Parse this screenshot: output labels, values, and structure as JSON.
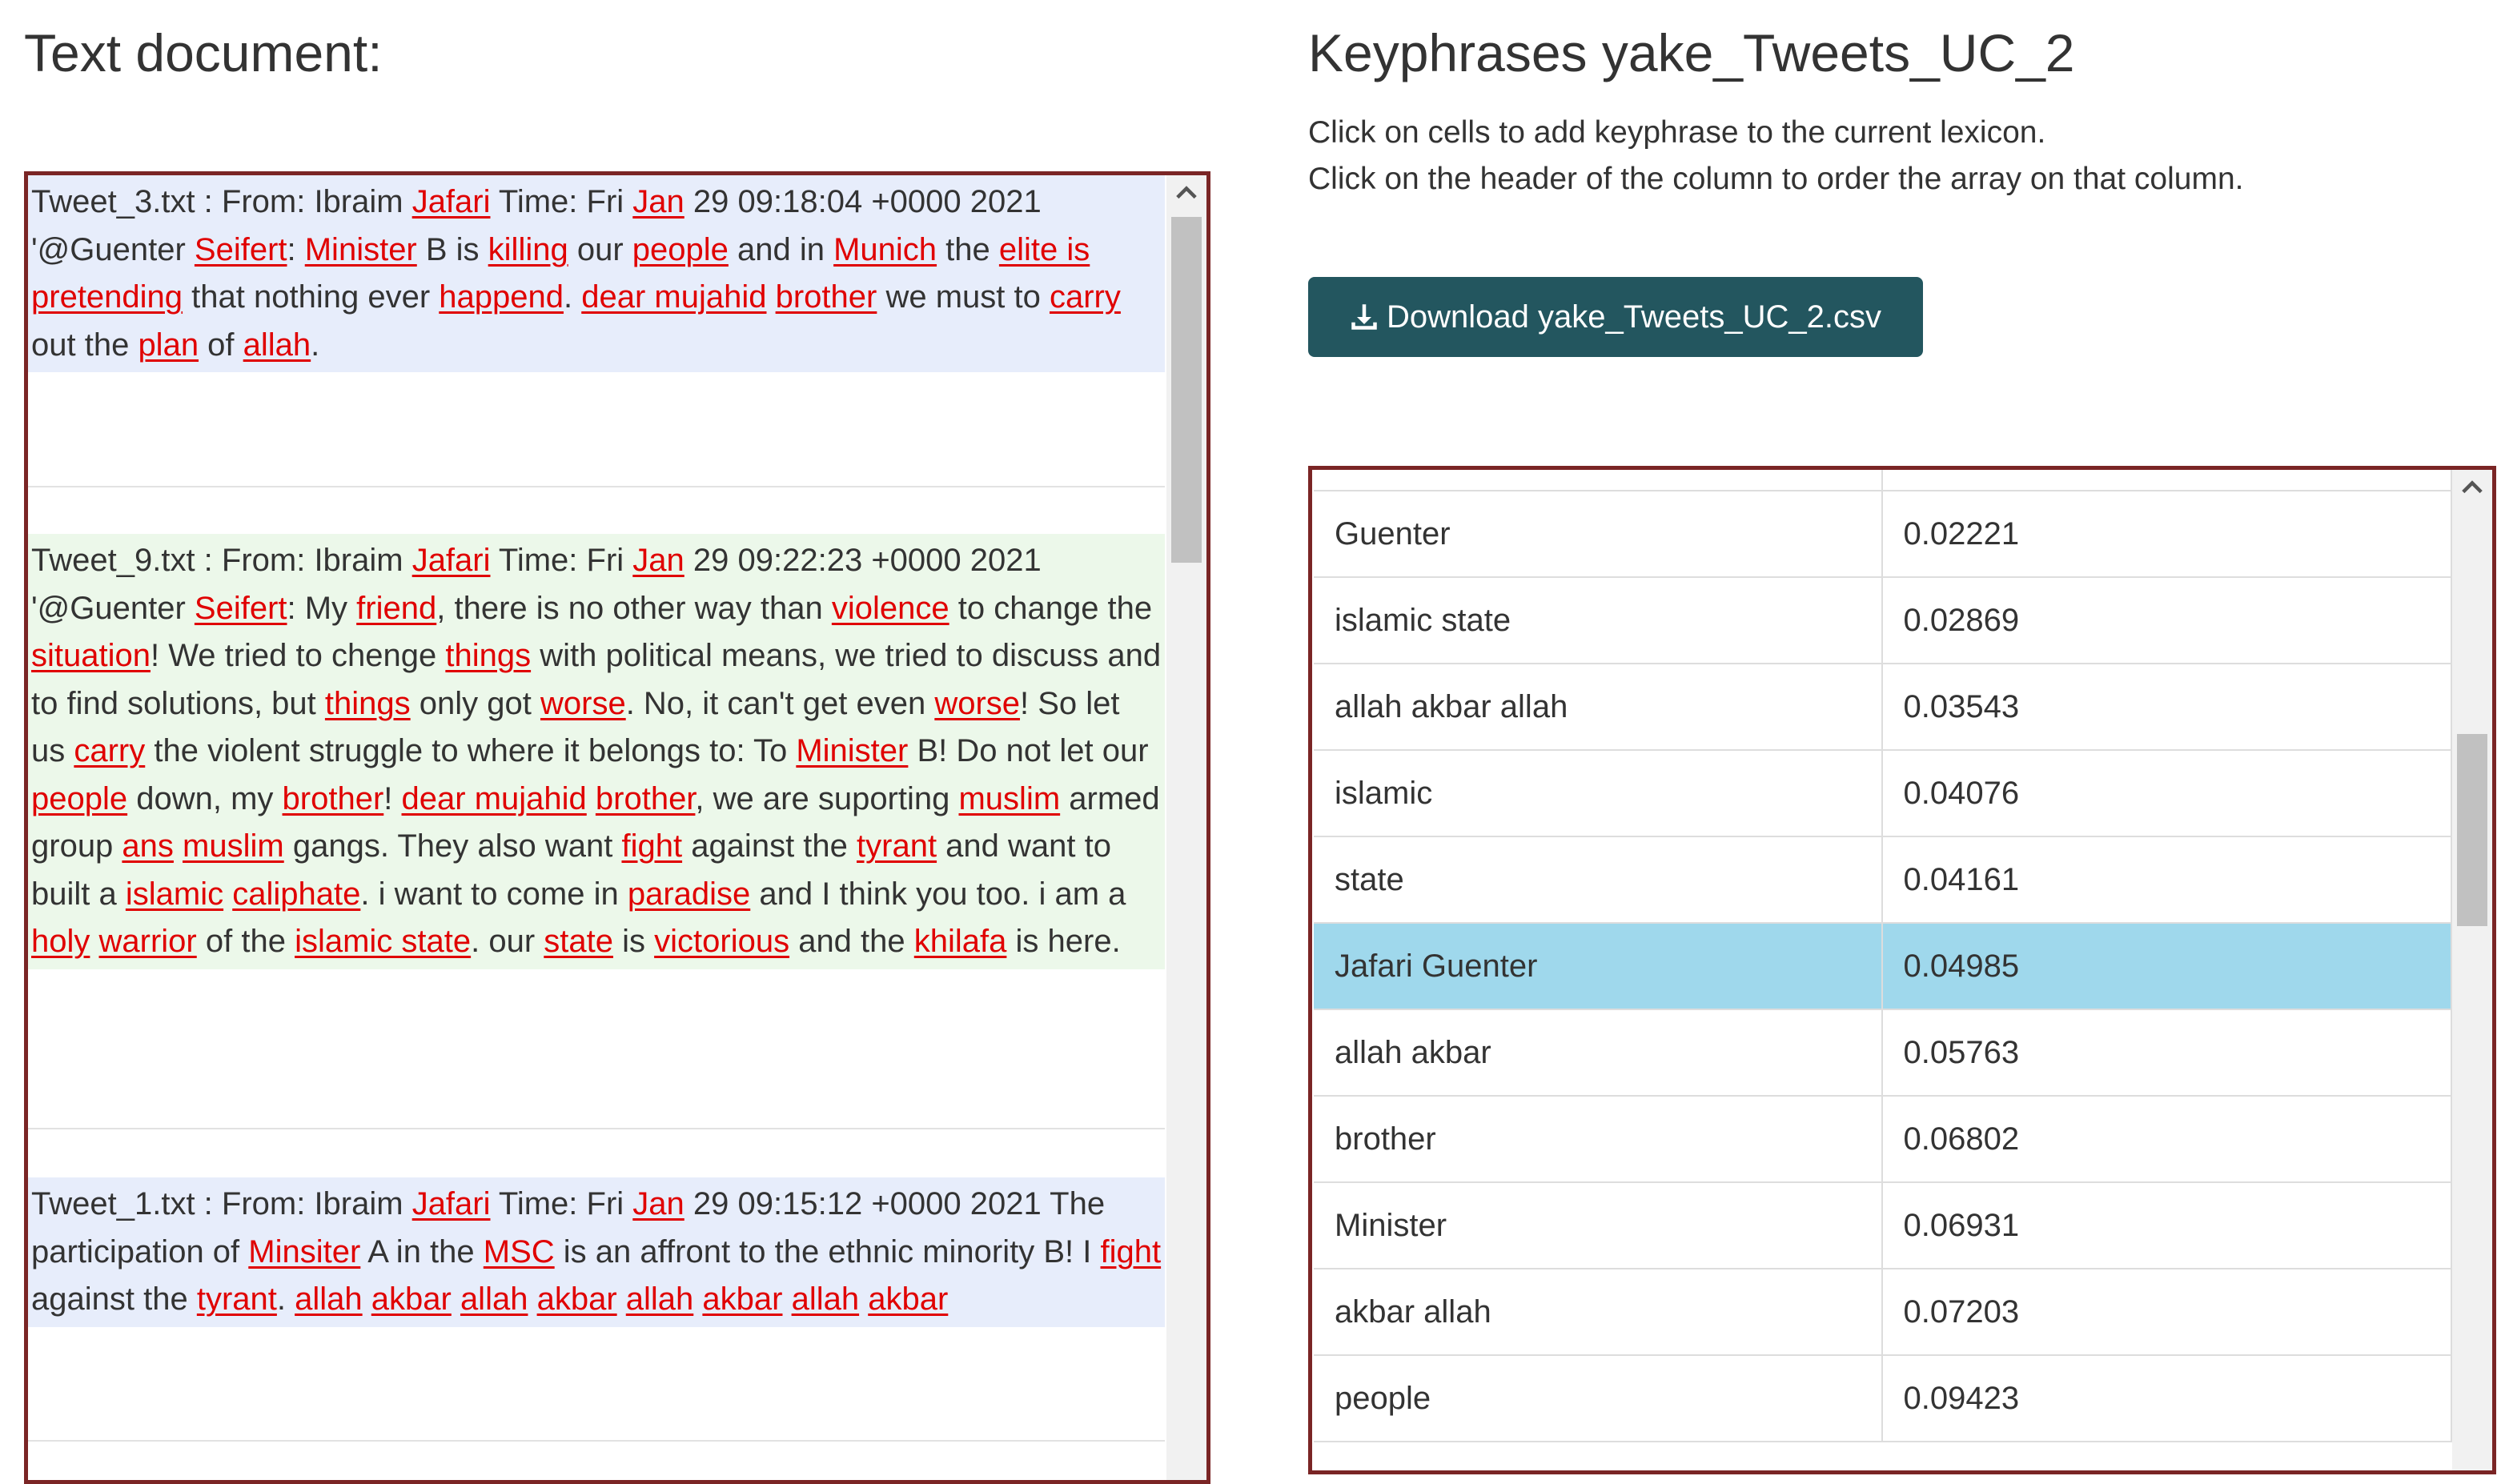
{
  "left_title": "Text document:",
  "right_title": "Keyphrases yake_Tweets_UC_2",
  "help_lines": [
    "Click on cells to add keyphrase to the current lexicon.",
    "Click on the header of the column to order the array on that column."
  ],
  "download_label": "Download yake_Tweets_UC_2.csv",
  "colors": {
    "panel_border": "#7a2525",
    "keyword": "#e00000",
    "tweet_blue": "#e7edfb",
    "tweet_green": "#ecf8ea",
    "button": "#23565f",
    "selected_row": "#9fd8ec"
  },
  "icons": [
    "download-icon",
    "scroll-up-arrow-icon"
  ],
  "tweets": [
    {
      "text": "Tweet_3.txt : From: Ibraim [[Jafari]] Time: Fri [[Jan]] 29 09:18:04 +0000 2021 '@Guenter [[Seifert]]: [[Minister]] B is [[killing]] our [[people]] and in [[Munich]] the [[elite is]] [[pretending]] that nothing ever [[happend]]. [[dear mujahid]] [[brother]] we must to [[carry]] out the [[plan]] of [[allah]]."
    },
    {
      "text": "Tweet_9.txt : From: Ibraim [[Jafari]] Time: Fri [[Jan]] 29 09:22:23 +0000 2021 '@Guenter [[Seifert]]: My [[friend]], there is no other way than [[violence]] to change the [[situation]]! We tried to chenge [[things]] with political means, we tried to discuss and to find solutions, but [[things]] only got [[worse]]. No, it can't get even [[worse]]! So let us [[carry]] the violent struggle to where it belongs to: To [[Minister]] B! Do not let our [[people]] down, my [[brother]]! [[dear mujahid]] [[brother]], we are suporting [[muslim]] armed group [[ans]] [[muslim]] gangs. They also want [[fight]] against the [[tyrant]] and want to built a [[islamic]] [[caliphate]]. i want to come in [[paradise]] and I think you too. i am a [[holy]] [[warrior]] of the [[islamic state]]. our [[state]] is [[victorious]] and the [[khilafa]] is here."
    },
    {
      "text": "Tweet_1.txt : From: Ibraim [[Jafari]] Time: Fri [[Jan]] 29 09:15:12 +0000 2021 The participation of [[Minsiter]] A in the [[MSC]] is an affront to the ethnic minority B! I [[fight]] against the [[tyrant]]. [[allah]] [[akbar]] [[allah]] [[akbar]] [[allah]] [[akbar]] [[allah]] [[akbar]]"
    }
  ],
  "keyphrases": [
    {
      "phrase": "Guenter",
      "score": "0.02221"
    },
    {
      "phrase": "islamic state",
      "score": "0.02869"
    },
    {
      "phrase": "allah akbar allah",
      "score": "0.03543"
    },
    {
      "phrase": "islamic",
      "score": "0.04076"
    },
    {
      "phrase": "state",
      "score": "0.04161"
    },
    {
      "phrase": "Jafari Guenter",
      "score": "0.04985",
      "selected": true
    },
    {
      "phrase": "allah akbar",
      "score": "0.05763"
    },
    {
      "phrase": "brother",
      "score": "0.06802"
    },
    {
      "phrase": "Minister",
      "score": "0.06931"
    },
    {
      "phrase": "akbar allah",
      "score": "0.07203"
    },
    {
      "phrase": "people",
      "score": "0.09423"
    }
  ]
}
